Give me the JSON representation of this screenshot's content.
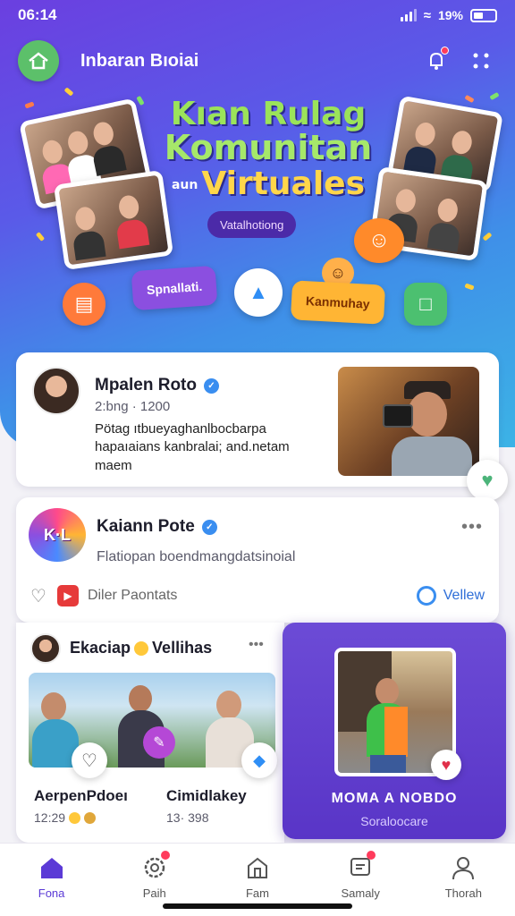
{
  "status": {
    "time": "06:14",
    "battery": "19%"
  },
  "header": {
    "title": "Inbaran Bıoiai"
  },
  "banner": {
    "line1": "Kıan Rulag",
    "line2": "Komunitan",
    "line3_prefix": "aun",
    "line3": "Virtuales",
    "pill": "Vatalhotiong",
    "chip_left": "Spnallati.",
    "chip_right": "Kanmuhay"
  },
  "post1": {
    "name": "Mpalen Roto",
    "meta": "2:bng   · 1200",
    "text": "Pötag ıtbueyaghanlbocbarpa hapaıaians kanbralai; and.netam maem"
  },
  "post2": {
    "name": "Kaiann Pote",
    "subtitle": "Flatiopan boendmangdatsinoial",
    "action_left": "Diler Paontats",
    "action_right": "Vellew"
  },
  "feed": {
    "author": "Ekaciap",
    "author_suffix": "Vellihas",
    "tile1_title": "AerpenPdoeı",
    "tile1_meta": "12:29",
    "tile2_title": "Cimidlakey",
    "tile2_meta": "13· 398"
  },
  "featured": {
    "title": "MOMA A NOBDO",
    "subtitle": "Soraloocare"
  },
  "nav": [
    {
      "label": "Fona",
      "icon": "home-icon"
    },
    {
      "label": "Paih",
      "icon": "gear-icon"
    },
    {
      "label": "Fam",
      "icon": "house-icon"
    },
    {
      "label": "Samaly",
      "icon": "chat-icon"
    },
    {
      "label": "Thorah",
      "icon": "profile-icon"
    }
  ],
  "colors": {
    "accent": "#5b3ad6",
    "hero_start": "#6b3fe0",
    "hero_end": "#3cb3e6",
    "badge": "#ff3b5c"
  }
}
